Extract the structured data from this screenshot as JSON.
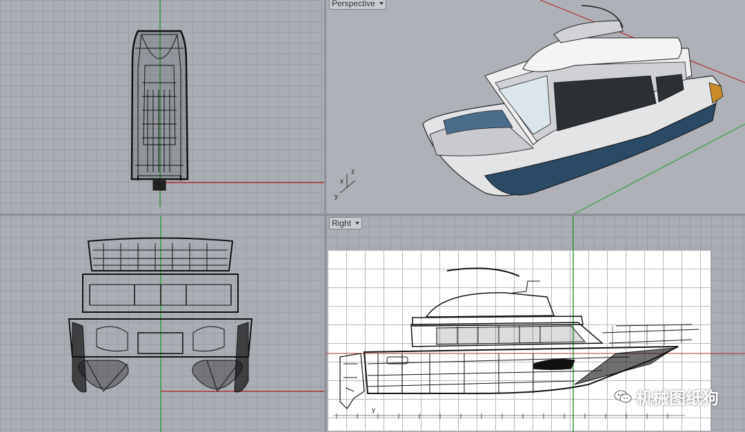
{
  "viewports": {
    "top": {
      "label": ""
    },
    "perspective": {
      "label": "Perspective"
    },
    "front": {
      "label": ""
    },
    "right": {
      "label": "Right"
    }
  },
  "axis_widget": {
    "x": "x",
    "y": "y",
    "z": "z"
  },
  "right_ruler": {
    "y_label": "y"
  },
  "watermark": {
    "text": "机械图纸狗"
  },
  "colors": {
    "viewport_bg": "#a9adb4",
    "grid": "#969aa2",
    "x_axis": "#b03030",
    "y_axis": "#2e9e3a",
    "hull_blue": "#24435d",
    "wire": "#111111"
  },
  "icons": {
    "viewport_menu": "chevron-down-icon",
    "watermark": "wechat-icon"
  }
}
